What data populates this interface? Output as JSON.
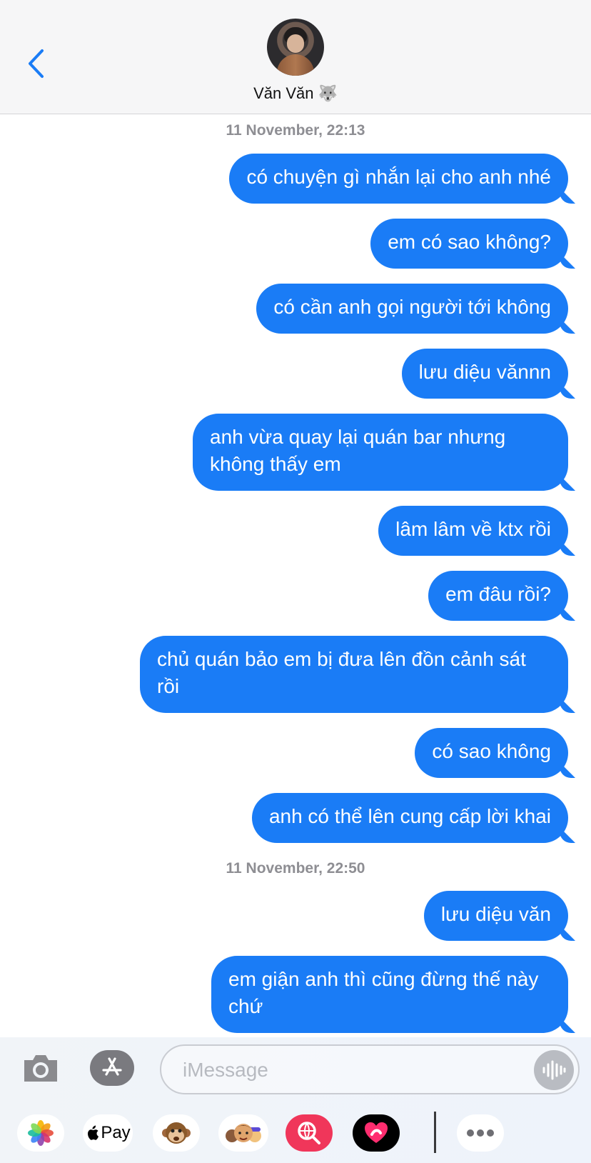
{
  "header": {
    "contact_name": "Văn Văn",
    "contact_emoji": "🐺"
  },
  "timestamps": [
    "11 November, 22:13",
    "11 November, 22:50"
  ],
  "messages": [
    {
      "text": "có chuyện gì nhắn lại cho anh nhé"
    },
    {
      "text": "em có sao không?"
    },
    {
      "text": "có cần anh gọi người tới không"
    },
    {
      "text": "lưu diệu vănnn"
    },
    {
      "text": "anh vừa quay lại quán bar nhưng không thấy em"
    },
    {
      "text": "lâm lâm về ktx rồi"
    },
    {
      "text": "em đâu rồi?"
    },
    {
      "text": "chủ quán bảo em bị đưa lên đồn cảnh sát rồi"
    },
    {
      "text": "có sao không"
    },
    {
      "text": "anh có thể lên cung cấp lời khai"
    },
    {
      "text": "lưu diệu văn"
    },
    {
      "text": "em giận anh thì cũng đừng thế này chứ"
    }
  ],
  "input": {
    "placeholder": "iMessage",
    "value": ""
  },
  "apps": {
    "applepay_label": "Pay",
    "icons": [
      "photos-icon",
      "apple-pay-icon",
      "animoji-icon",
      "memoji-icon",
      "web-search-icon",
      "digital-touch-icon",
      "more-icon"
    ]
  },
  "colors": {
    "bubble": "#1a7cf6",
    "accent": "#1a7cf6",
    "timestamp": "#8e8e93"
  }
}
